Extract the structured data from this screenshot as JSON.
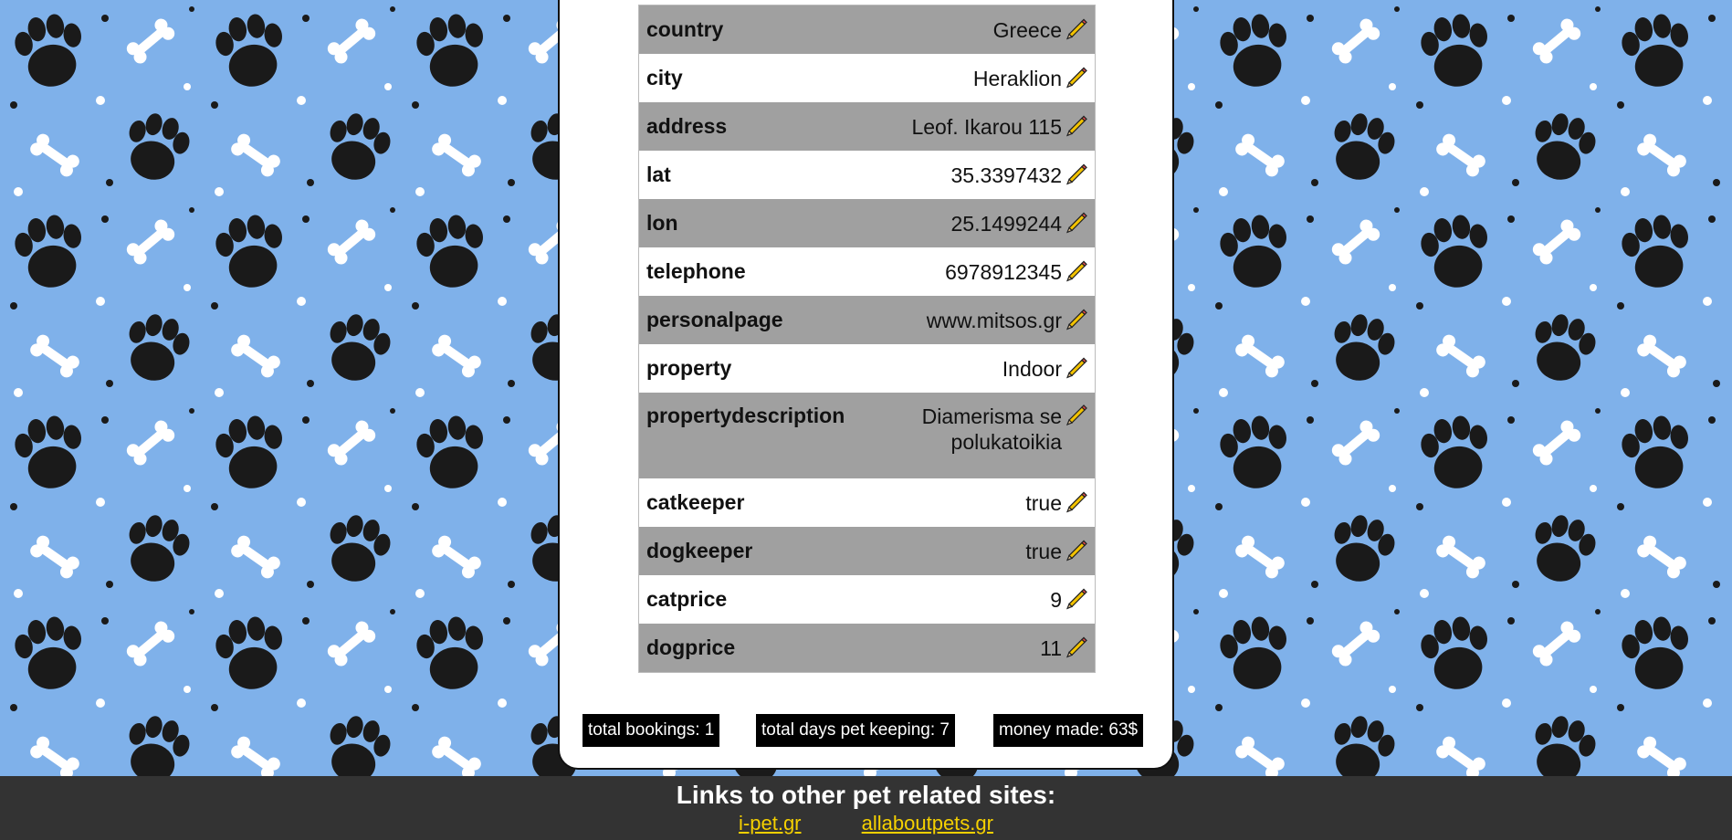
{
  "colors": {
    "page_background": "#7fb1ea",
    "row_shaded": "#a0a0a0",
    "row_plain": "#ffffff",
    "footer_background": "#333333",
    "link_color": "#f5d000",
    "badge_background": "#000000"
  },
  "profile": {
    "rows": [
      {
        "field": "country",
        "value": "Greece"
      },
      {
        "field": "city",
        "value": "Heraklion"
      },
      {
        "field": "address",
        "value": "Leof. Ikarou 115"
      },
      {
        "field": "lat",
        "value": "35.3397432"
      },
      {
        "field": "lon",
        "value": "25.1499244"
      },
      {
        "field": "telephone",
        "value": "6978912345"
      },
      {
        "field": "personalpage",
        "value": "www.mitsos.gr"
      },
      {
        "field": "property",
        "value": "Indoor"
      },
      {
        "field": "propertydescription",
        "value": "Diamerisma se polukatoikia"
      },
      {
        "field": "catkeeper",
        "value": "true"
      },
      {
        "field": "dogkeeper",
        "value": "true"
      },
      {
        "field": "catprice",
        "value": "9"
      },
      {
        "field": "dogprice",
        "value": "11"
      }
    ],
    "edit_icon": "pencil-icon"
  },
  "stats": {
    "total_bookings": "total bookings: 1",
    "total_days": "total days pet keeping: 7",
    "money_made": "money made: 63$"
  },
  "footer": {
    "title": "Links to other pet related sites:",
    "links": [
      {
        "label": "i-pet.gr"
      },
      {
        "label": "allaboutpets.gr"
      }
    ]
  }
}
